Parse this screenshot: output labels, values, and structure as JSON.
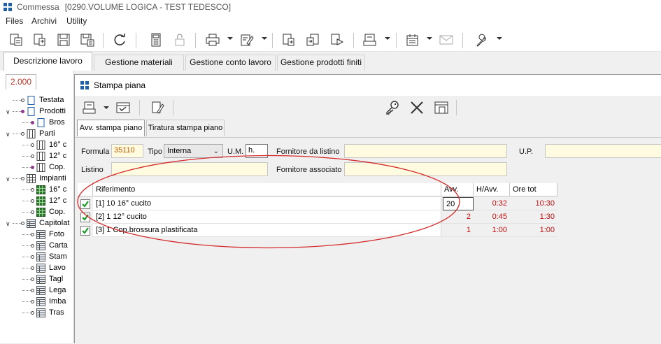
{
  "window": {
    "app_name": "Commessa",
    "doc_title": "[0290.VOLUME LOGICA - TEST TEDESCO]"
  },
  "menu": [
    "Files",
    "Archivi",
    "Utility"
  ],
  "main_tabs": [
    "Descrizione lavoro",
    "Gestione materiali",
    "Gestione conto lavoro",
    "Gestione prodotti finiti"
  ],
  "left_panel": {
    "year_tab": "2.000",
    "tree": [
      {
        "label": "Testata",
        "level": 1
      },
      {
        "label": "Prodotti",
        "level": 1
      },
      {
        "label": "Bros",
        "level": 2
      },
      {
        "label": "Parti",
        "level": 1
      },
      {
        "label": "16° c",
        "level": 2
      },
      {
        "label": "12° c",
        "level": 2
      },
      {
        "label": "Cop.",
        "level": 2
      },
      {
        "label": "Impianti",
        "level": 1
      },
      {
        "label": "16° c",
        "level": 2
      },
      {
        "label": "12° c",
        "level": 2
      },
      {
        "label": "Cop.",
        "level": 2
      },
      {
        "label": "Capitolat",
        "level": 1
      },
      {
        "label": "Foto",
        "level": 2
      },
      {
        "label": "Carta",
        "level": 2
      },
      {
        "label": "Stam",
        "level": 2
      },
      {
        "label": "Lavo",
        "level": 2
      },
      {
        "label": "Tagl",
        "level": 2
      },
      {
        "label": "Lega",
        "level": 2
      },
      {
        "label": "Imba",
        "level": 2
      },
      {
        "label": "Tras",
        "level": 2
      }
    ]
  },
  "modal": {
    "title": "Stampa piana",
    "sub_tabs": [
      "Avv. stampa piano",
      "Tiratura stampa piano"
    ],
    "form": {
      "formula_label": "Formula",
      "formula_value": "35110",
      "tipo_label": "Tipo",
      "tipo_value": "Interna",
      "um_label": "U.M.",
      "um_value": "h.",
      "fornitore_listino_label": "Fornitore da listino",
      "fornitore_listino_value": "",
      "up_label": "U.P.",
      "up_value": "",
      "listino_label": "Listino",
      "listino_value": "",
      "fornitore_assoc_label": "Fornitore associato",
      "fornitore_assoc_value": ""
    },
    "grid": {
      "headers": [
        "Riferimento",
        "Avv.",
        "H/Avv.",
        "Ore tot"
      ],
      "rows": [
        {
          "ref": "[1] 10 16° cucito",
          "avv": "20",
          "h_avv": "0:32",
          "ore_tot": "10:30"
        },
        {
          "ref": "[2] 1 12° cucito",
          "avv": "2",
          "h_avv": "0:45",
          "ore_tot": "1:30"
        },
        {
          "ref": "[3] 1 Cop.brossura plastificata",
          "avv": "1",
          "h_avv": "1:00",
          "ore_tot": "1:00"
        }
      ]
    }
  },
  "colors": {
    "accent_blue": "#1f5fa8",
    "value_red": "#c01010",
    "annotation_red": "#d42a2a",
    "field_yellow": "#fffbe0"
  }
}
